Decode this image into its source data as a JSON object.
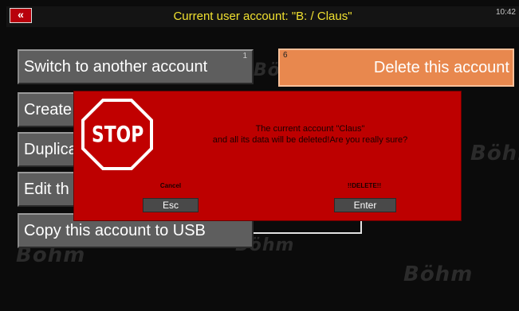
{
  "header": {
    "back_symbol": "«",
    "title": "Current user account: \"B: / Claus\"",
    "clock": "10:42"
  },
  "watermark": {
    "brand": "Böhm"
  },
  "menu": {
    "switch": {
      "label": "Switch to another account",
      "number": "1"
    },
    "create": {
      "label": "Create"
    },
    "duplicate": {
      "label": "Duplica"
    },
    "edit": {
      "label": "Edit th"
    },
    "copy": {
      "label": "Copy this account to USB"
    },
    "delete": {
      "label": "Delete this account",
      "number": "6"
    }
  },
  "dialog": {
    "stop_text": "STOP",
    "message_line1": "The current account \"Claus\"",
    "message_line2": "and all its data will be deleted!Are you really sure?",
    "cancel": {
      "caption": "Cancel",
      "key": "Esc"
    },
    "confirm": {
      "caption": "!!DELETE!!",
      "key": "Enter"
    }
  },
  "colors": {
    "title_yellow": "#f0e030",
    "dialog_red": "#bd0000",
    "delete_orange": "#e8884e",
    "button_gray": "#5e5e5e"
  }
}
